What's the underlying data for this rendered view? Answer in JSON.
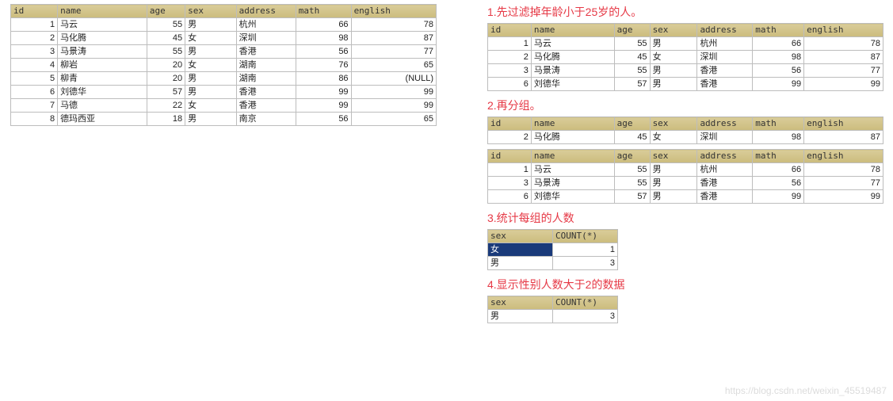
{
  "columns": [
    "id",
    "name",
    "age",
    "sex",
    "address",
    "math",
    "english"
  ],
  "main_table": [
    {
      "id": 1,
      "name": "马云",
      "age": 55,
      "sex": "男",
      "address": "杭州",
      "math": 66,
      "english": 78
    },
    {
      "id": 2,
      "name": "马化腾",
      "age": 45,
      "sex": "女",
      "address": "深圳",
      "math": 98,
      "english": 87
    },
    {
      "id": 3,
      "name": "马景涛",
      "age": 55,
      "sex": "男",
      "address": "香港",
      "math": 56,
      "english": 77
    },
    {
      "id": 4,
      "name": "柳岩",
      "age": 20,
      "sex": "女",
      "address": "湖南",
      "math": 76,
      "english": 65
    },
    {
      "id": 5,
      "name": "柳青",
      "age": 20,
      "sex": "男",
      "address": "湖南",
      "math": 86,
      "english": "(NULL)"
    },
    {
      "id": 6,
      "name": "刘德华",
      "age": 57,
      "sex": "男",
      "address": "香港",
      "math": 99,
      "english": 99
    },
    {
      "id": 7,
      "name": "马德",
      "age": 22,
      "sex": "女",
      "address": "香港",
      "math": 99,
      "english": 99
    },
    {
      "id": 8,
      "name": "德玛西亚",
      "age": 18,
      "sex": "男",
      "address": "南京",
      "math": 56,
      "english": 65
    }
  ],
  "steps": {
    "s1": {
      "title": "1.先过滤掉年龄小于25岁的人。",
      "rows": [
        {
          "id": 1,
          "name": "马云",
          "age": 55,
          "sex": "男",
          "address": "杭州",
          "math": 66,
          "english": 78
        },
        {
          "id": 2,
          "name": "马化腾",
          "age": 45,
          "sex": "女",
          "address": "深圳",
          "math": 98,
          "english": 87
        },
        {
          "id": 3,
          "name": "马景涛",
          "age": 55,
          "sex": "男",
          "address": "香港",
          "math": 56,
          "english": 77
        },
        {
          "id": 6,
          "name": "刘德华",
          "age": 57,
          "sex": "男",
          "address": "香港",
          "math": 99,
          "english": 99
        }
      ]
    },
    "s2": {
      "title": "2.再分组。",
      "group_a": [
        {
          "id": 2,
          "name": "马化腾",
          "age": 45,
          "sex": "女",
          "address": "深圳",
          "math": 98,
          "english": 87
        }
      ],
      "group_b": [
        {
          "id": 1,
          "name": "马云",
          "age": 55,
          "sex": "男",
          "address": "杭州",
          "math": 66,
          "english": 78
        },
        {
          "id": 3,
          "name": "马景涛",
          "age": 55,
          "sex": "男",
          "address": "香港",
          "math": 56,
          "english": 77
        },
        {
          "id": 6,
          "name": "刘德华",
          "age": 57,
          "sex": "男",
          "address": "香港",
          "math": 99,
          "english": 99
        }
      ]
    },
    "s3": {
      "title": "3.统计每组的人数",
      "columns": [
        "sex",
        "COUNT(*)"
      ],
      "rows": [
        {
          "sex": "女",
          "count": 1,
          "highlight": true
        },
        {
          "sex": "男",
          "count": 3
        }
      ]
    },
    "s4": {
      "title": "4.显示性别人数大于2的数据",
      "columns": [
        "sex",
        "COUNT(*)"
      ],
      "rows": [
        {
          "sex": "男",
          "count": 3
        }
      ]
    }
  },
  "watermark": "https://blog.csdn.net/weixin_45519487"
}
